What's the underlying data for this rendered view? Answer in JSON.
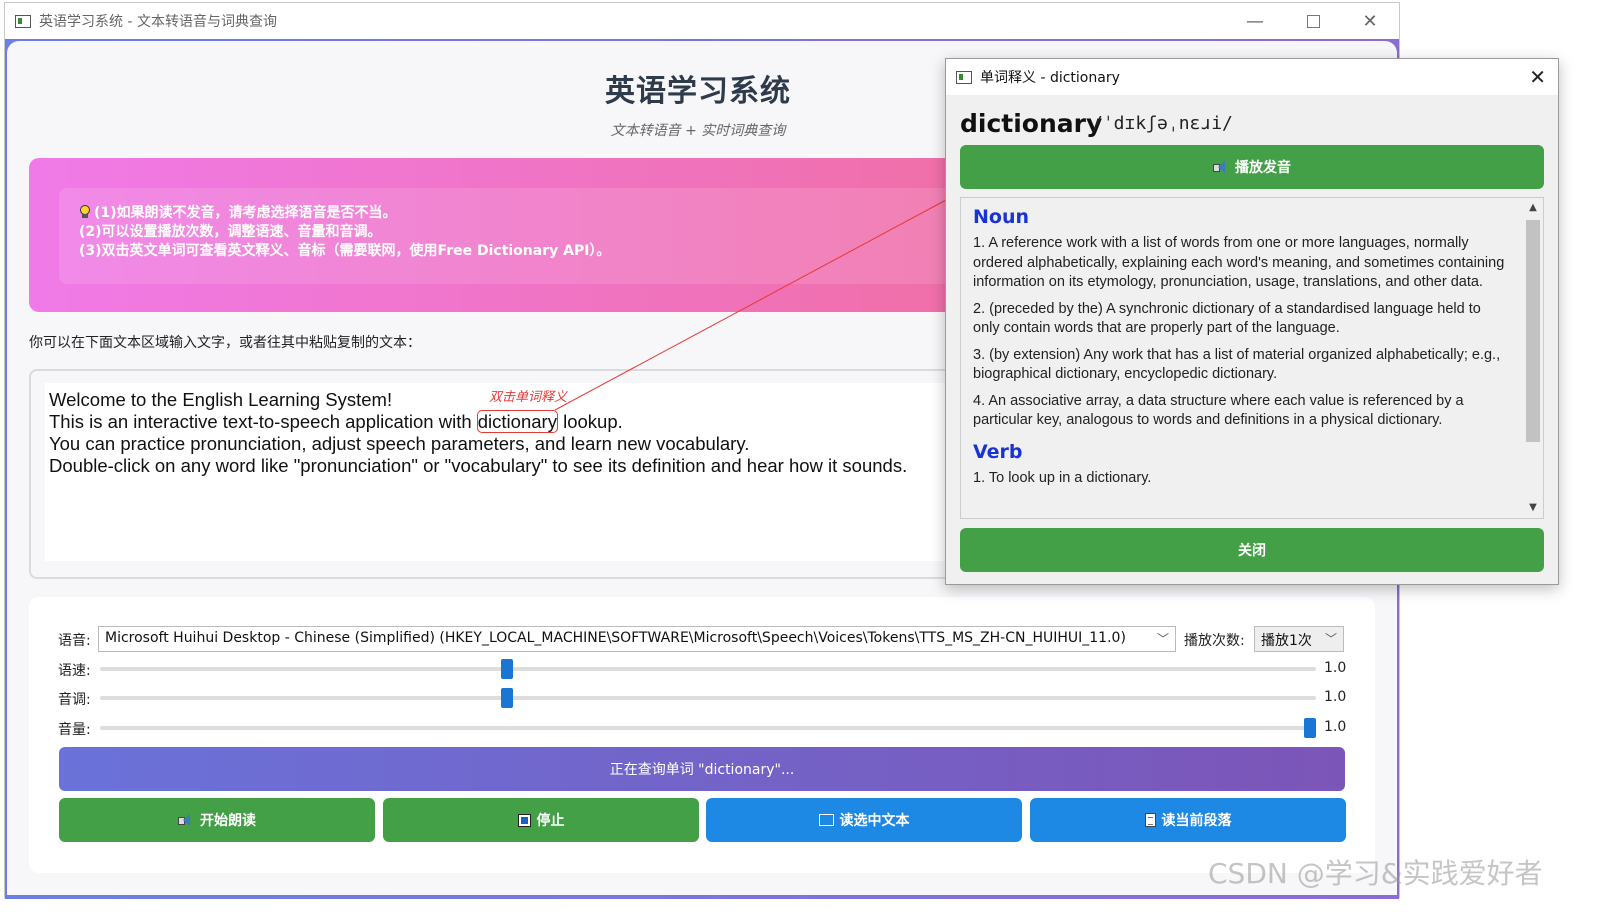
{
  "main_window": {
    "title": "英语学习系统 - 文本转语音与词典查询",
    "controls": {
      "minimize": "—",
      "close": "✕"
    }
  },
  "app": {
    "title": "英语学习系统",
    "subtitle": "文本转语音 + 实时词典查询",
    "tips": [
      "(1)如果朗读不发音，请考虑选择语音是否不当。",
      "(2)可以设置播放次数，调整语速、音量和音调。",
      "(3)双击英文单词可查看英文释义、音标（需要联网，使用Free Dictionary API）。"
    ],
    "text_prompt": "你可以在下面文本区域输入文字，或者往其中粘贴复制的文本：",
    "text_content": {
      "line1": "Welcome to the English Learning System!",
      "line2_before": "This is an interactive text-to-speech application with ",
      "line2_word": "dictionary",
      "line2_after": " lookup.",
      "line3": "You can practice pronunciation, adjust speech parameters, and learn new vocabulary.",
      "line4": "Double-click on any word like \"pronunciation\" or \"vocabulary\" to see its definition and hear how it sounds."
    },
    "annotation": "双击单词释义"
  },
  "controls": {
    "voice_label": "语音:",
    "voice_value": "Microsoft Huihui Desktop - Chinese (Simplified) (HKEY_LOCAL_MACHINE\\SOFTWARE\\Microsoft\\Speech\\Voices\\Tokens\\TTS_MS_ZH-CN_HUIHUI_11.0)",
    "repeat_label": "播放次数:",
    "repeat_value": "播放1次",
    "rate_label": "语速:",
    "rate_value": "1.0",
    "rate_level": 0.333,
    "pitch_label": "音调:",
    "pitch_value": "1.0",
    "pitch_level": 0.333,
    "volume_label": "音量:",
    "volume_value": "1.0",
    "volume_level": 1.0,
    "status": "正在查询单词 \"dictionary\"...",
    "buttons": {
      "start": "开始朗读",
      "stop": "停止",
      "read_selected": "读选中文本",
      "read_paragraph": "读当前段落"
    }
  },
  "watermark": "CSDN @学习&实践爱好者",
  "dialog": {
    "title": "单词释义 - dictionary",
    "word": "dictionary",
    "phonetic": "/ˈdɪkʃəˌnɛɹi/",
    "play_button": "播放发音",
    "close_button": "关闭",
    "noun_heading": "Noun",
    "noun_defs": [
      "1. A reference work with a list of words from one or more languages, normally ordered alphabetically, explaining each word's meaning, and sometimes containing information on its etymology, pronunciation, usage, translations, and other data.",
      "2. (preceded by the) A synchronic dictionary of a standardised language held to only contain words that are properly part of the language.",
      "3. (by extension) Any work that has a list of material organized alphabetically; e.g., biographical dictionary, encyclopedic dictionary.",
      "4. An associative array, a data structure where each value is referenced by a particular key, analogous to words and definitions in a physical dictionary."
    ],
    "verb_heading": "Verb",
    "verb_defs": [
      "1. To look up in a dictionary."
    ]
  },
  "colors": {
    "green_button": "#43a047",
    "blue_button": "#1e88e5",
    "pos_heading": "#1a33d6",
    "annotation": "#e53935"
  }
}
